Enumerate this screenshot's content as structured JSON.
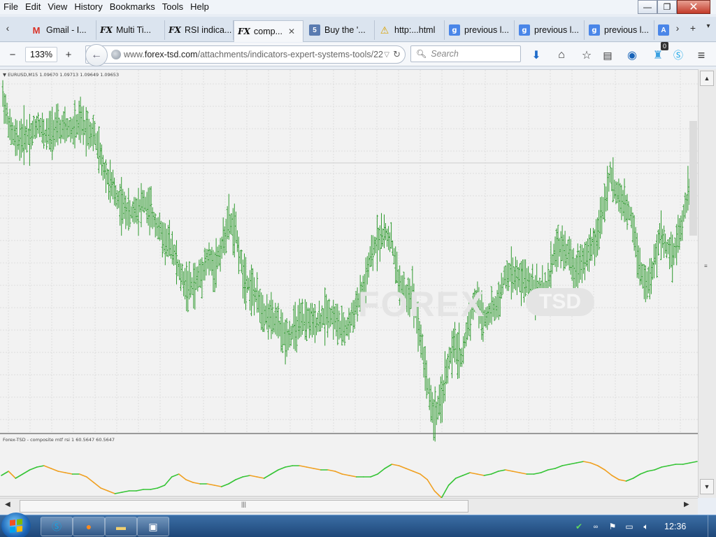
{
  "window": {
    "menu": [
      "File",
      "Edit",
      "View",
      "History",
      "Bookmarks",
      "Tools",
      "Help"
    ],
    "controls": {
      "minimize": "—",
      "maximize": "❐",
      "close": "✕"
    }
  },
  "tabs": [
    {
      "label": "Gmail - I...",
      "icon": "gmail-icon",
      "glyph": "M"
    },
    {
      "label": "Multi Ti...",
      "icon": "forex-tsd-icon",
      "glyph": "FX"
    },
    {
      "label": "RSI indica...",
      "icon": "forex-tsd-icon",
      "glyph": "FX"
    },
    {
      "label": "comp...",
      "icon": "forex-tsd-icon",
      "glyph": "FX",
      "active": true,
      "close": "✕"
    },
    {
      "label": "Buy the '...",
      "icon": "site-five-icon",
      "glyph": "5"
    },
    {
      "label": "http:...html",
      "icon": "warning-icon",
      "glyph": "⚠"
    },
    {
      "label": "previous l...",
      "icon": "google-icon",
      "glyph": "g"
    },
    {
      "label": "previous l...",
      "icon": "google-icon",
      "glyph": "g"
    },
    {
      "label": "previous l...",
      "icon": "google-icon",
      "glyph": "g"
    }
  ],
  "tab_overflow": {
    "glyph": "A"
  },
  "toolbar": {
    "zoom_out": "−",
    "zoom_level": "133%",
    "zoom_in": "+",
    "url_prefix": "www.",
    "url_domain": "forex-tsd.com",
    "url_path": "/attachments/indicators-expert-systems-tools/22",
    "search_placeholder": "Search",
    "notification_count": "0"
  },
  "chart": {
    "symbol_header": "EURUSD,M15  1.09670 1.09713 1.09649 1.09653",
    "indicator_header": "Forex-TSD - composite mtf rsi 1 60.5647 60.5647",
    "watermark": "FOREX",
    "watermark_badge": "TSD",
    "colors": {
      "candles": "#2f9a2f",
      "indicator_up": "#35c435",
      "indicator_down": "#f0a020",
      "grid": "#dedede",
      "bg": "#f2f2f2"
    }
  },
  "chart_data": {
    "type": "line",
    "series": [
      {
        "values": [
          1.105,
          1.1,
          1.098,
          1.099,
          1.099,
          1.101,
          1.099,
          1.1,
          1.1,
          1.1,
          1.1,
          1.101,
          1.1,
          1.099,
          1.095,
          1.092,
          1.09,
          1.088,
          1.087,
          1.088,
          1.089,
          1.087,
          1.085,
          1.083,
          1.082,
          1.078,
          1.076,
          1.076,
          1.078,
          1.08,
          1.079,
          1.082,
          1.086,
          1.084,
          1.078,
          1.076,
          1.074,
          1.072,
          1.071,
          1.07,
          1.068,
          1.069,
          1.07,
          1.071,
          1.07,
          1.071,
          1.072,
          1.071,
          1.069,
          1.07,
          1.073,
          1.075,
          1.08,
          1.083,
          1.084,
          1.083,
          1.077,
          1.074,
          1.075,
          1.069,
          1.062,
          1.056,
          1.058,
          1.064,
          1.067,
          1.065,
          1.071,
          1.074,
          1.071,
          1.072,
          1.073,
          1.077,
          1.078,
          1.077,
          1.077,
          1.076,
          1.075,
          1.075,
          1.081,
          1.082,
          1.081,
          1.078,
          1.08,
          1.081,
          1.083,
          1.088,
          1.093,
          1.09,
          1.088,
          1.087,
          1.08,
          1.076,
          1.078,
          1.084,
          1.082,
          1.081,
          1.085,
          1.09,
          1.091
        ],
        "name": ""
      },
      {
        "values": [
          51,
          54,
          49,
          52,
          55,
          57,
          58,
          56,
          54,
          53,
          52,
          52,
          50,
          46,
          42,
          40,
          38,
          39,
          40,
          40,
          41,
          41,
          42,
          44,
          50,
          52,
          48,
          46,
          45,
          45,
          44,
          43,
          45,
          48,
          50,
          51,
          50,
          49,
          52,
          55,
          57,
          58,
          58,
          57,
          56,
          55,
          55,
          54,
          52,
          51,
          50,
          50,
          50,
          52,
          56,
          59,
          58,
          56,
          54,
          52,
          48,
          40,
          35,
          44,
          49,
          51,
          53,
          52,
          51,
          52,
          54,
          55,
          54,
          53,
          52,
          52,
          53,
          55,
          56,
          58,
          59,
          60,
          61,
          60,
          58,
          55,
          51,
          48,
          47,
          49,
          52,
          54,
          55,
          57,
          58,
          59,
          59,
          60,
          61
        ],
        "name": ""
      }
    ]
  }
}
